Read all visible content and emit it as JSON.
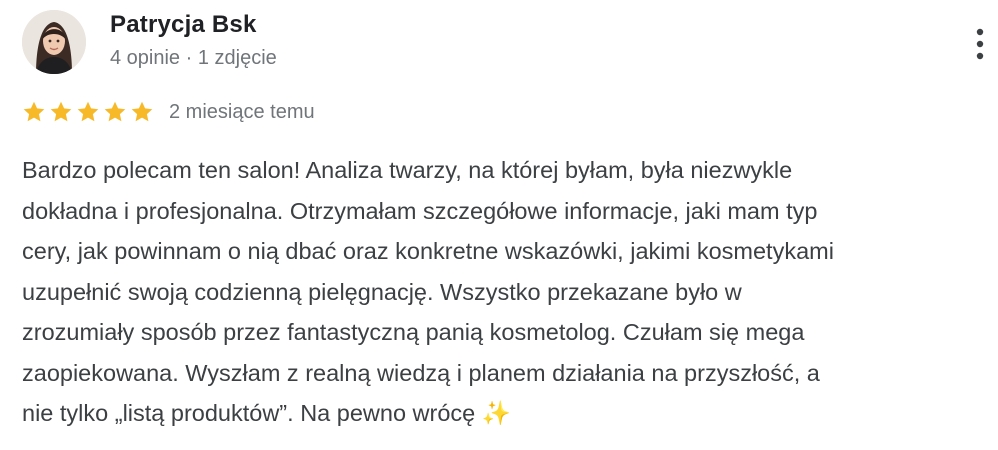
{
  "review": {
    "author": {
      "name": "Patrycja Bsk",
      "meta": "4 opinie · 1 zdjęcie",
      "avatar_icon": "profile-photo"
    },
    "rating": {
      "stars": 5,
      "max_stars": 5,
      "star_color": "#f7b928",
      "date": "2 miesiące temu"
    },
    "text_lines": [
      "Bardzo polecam ten salon! Analiza twarzy, na której byłam, była niezwykle",
      "dokładna i profesjonalna. Otrzymałam szczegółowe informacje, jaki mam typ",
      "cery, jak powinnam o nią dbać oraz konkretne wskazówki, jakimi kosmetykami",
      "uzupełnić swoją codzienną pielęgnację. Wszystko przekazane było w",
      "zrozumiały sposób przez fantastyczną panią kosmetolog. Czułam się mega",
      "zaopiekowana. Wyszłam z realną wiedzą i planem działania na przyszłość, a",
      "nie tylko „listą produktów”. Na pewno wrócę ✨"
    ],
    "menu_icon": "more-vert-icon"
  }
}
